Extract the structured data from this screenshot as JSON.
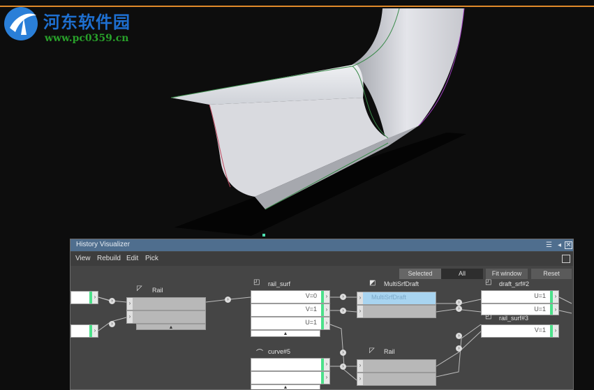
{
  "watermark": {
    "title": "河东软件园",
    "url": "www.pc0359.cn"
  },
  "window": {
    "title": "History Visualizer",
    "menu": [
      "View",
      "Rebuild",
      "Edit",
      "Pick"
    ],
    "tabs": [
      "Selected",
      "All"
    ],
    "buttons": [
      "Fit window",
      "Reset"
    ]
  },
  "nodes": {
    "rail_left": "Rail",
    "rail_surf": "rail_surf",
    "rail_surf_values": [
      "V=0",
      "V=1",
      "U=1"
    ],
    "curve": "curve#5",
    "multi": "MultiSrfDraft",
    "multi_sel": "MultiSrfDraft",
    "rail_mid": "Rail",
    "draft": "draft_srf#2",
    "draft_values": [
      "U=1",
      "U=1"
    ],
    "rail_surf3": "rail_surf#3",
    "rail_surf3_values": [
      "V=1"
    ]
  },
  "colors": {
    "accent": "#e08a2a",
    "title_bar": "#4f6e8e",
    "port_green": "#4ce08a"
  }
}
